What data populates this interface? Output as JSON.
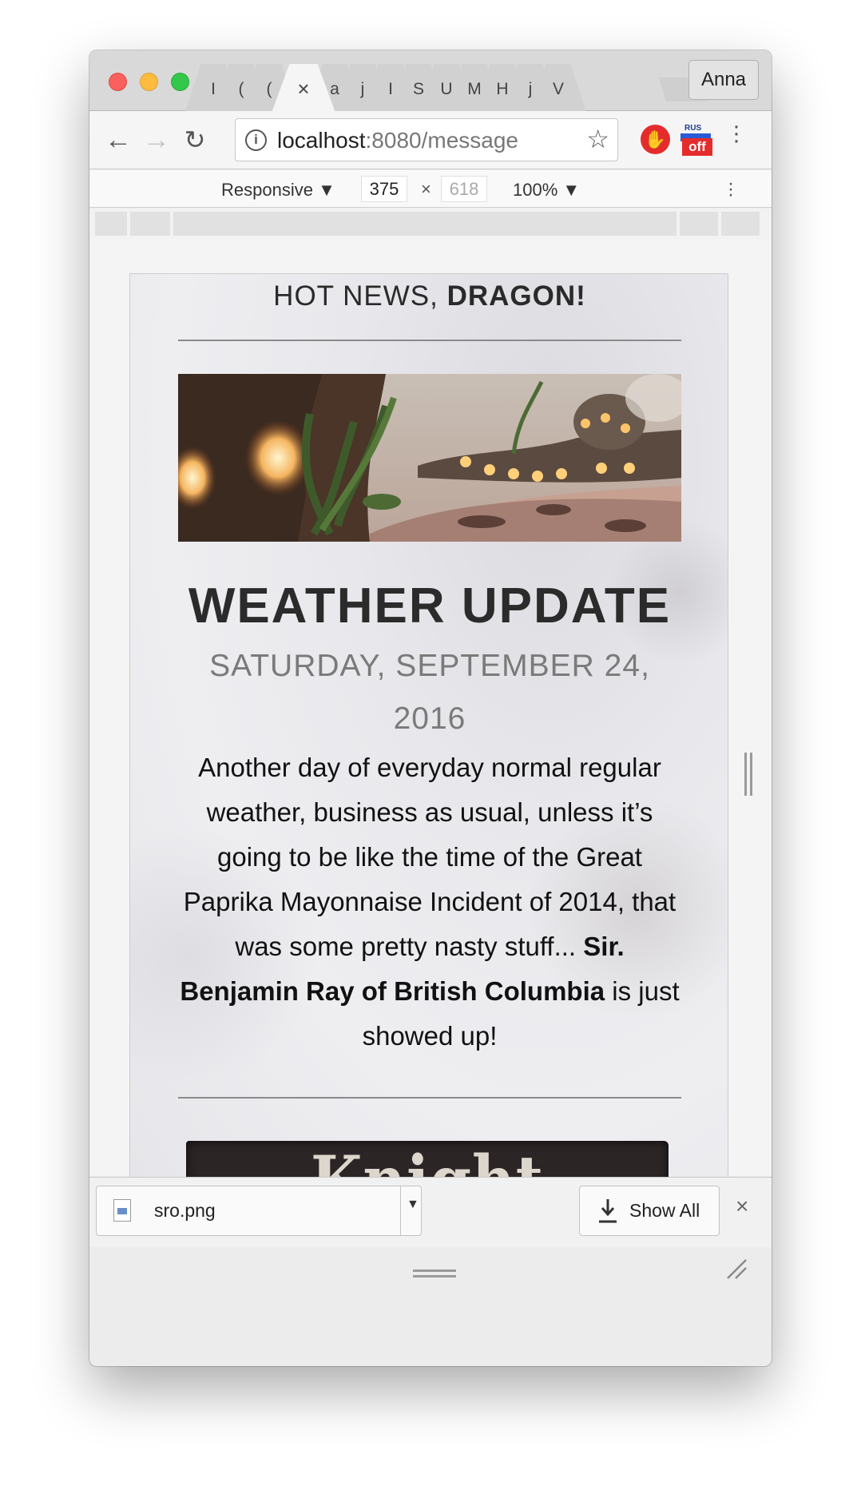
{
  "browser": {
    "profile_name": "Anna",
    "tabs": [
      "I",
      "(",
      "(",
      "",
      "a",
      "j",
      "I",
      "S",
      "U",
      "M",
      "H",
      "j",
      "V"
    ],
    "active_tab_close": "×",
    "url": {
      "host": "localhost",
      "path": ":8080/message"
    },
    "ext_rus_label": "RUS",
    "ext_off_label": "off"
  },
  "device_toolbar": {
    "mode": "Responsive ▼",
    "width": "375",
    "times": "×",
    "height": "618",
    "zoom": "100% ▼"
  },
  "page": {
    "greeting": "HOT NEWS, ",
    "greeting_name": "DRAGON!",
    "headline": "WEATHER UPDATE",
    "dateline": "SATURDAY, SEPTEMBER 24, 2016",
    "body_plain": "Another day of everyday normal regular weather, business as usual, unless it’s going to be like the time of the Great Paprika Mayonnaise Incident of 2014, that was some pretty nasty stuff... ",
    "body_bold": "Sir. Benjamin Ray of British Columbia",
    "body_tail": " is just showed up!",
    "knight_monthly": "Knight Monthly"
  },
  "downloads": {
    "file_name": "sro.png",
    "show_all": "Show All",
    "close": "×"
  },
  "colors": {
    "close_red": "#fc605c",
    "minimize_yellow": "#fdbc40",
    "zoom_green": "#34c84a",
    "ext_red": "#e52c2c"
  }
}
